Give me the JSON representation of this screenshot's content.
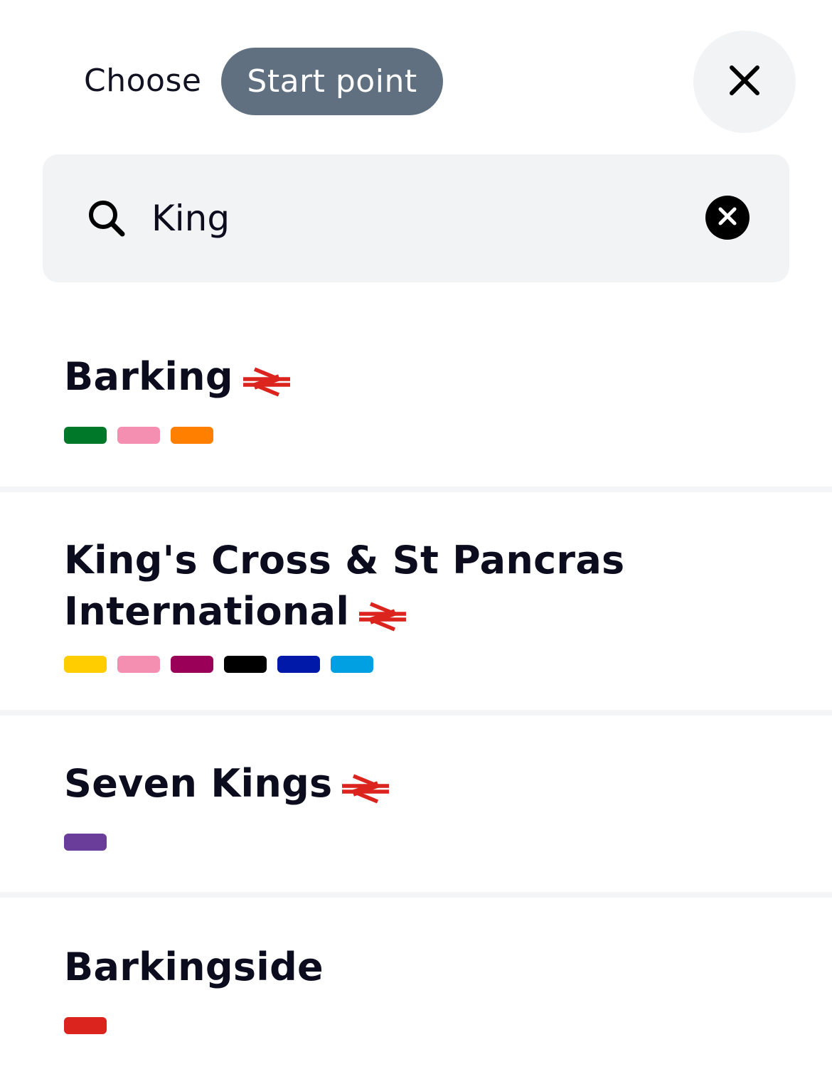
{
  "header": {
    "choose_label": "Choose",
    "mode_pill": "Start point",
    "close_icon": "close-icon"
  },
  "search": {
    "value": "King",
    "search_icon": "search-icon",
    "clear_icon": "clear-circle-icon"
  },
  "results": [
    {
      "name": "Barking",
      "national_rail": true,
      "lines": [
        "#00782a",
        "#f48fb1",
        "#ff7f00"
      ]
    },
    {
      "name": "King's Cross & St Pancras International",
      "national_rail": true,
      "lines": [
        "#ffcd00",
        "#f48fb1",
        "#9b0058",
        "#000000",
        "#0019a8",
        "#00a0e2"
      ]
    },
    {
      "name": "Seven Kings",
      "national_rail": true,
      "lines": [
        "#6a3d9a"
      ]
    },
    {
      "name": "Barkingside",
      "national_rail": false,
      "lines": [
        "#dc241f"
      ]
    }
  ],
  "colors": {
    "pill_bg": "#617080",
    "panel_bg": "#f2f3f5",
    "rail_red": "#dc241f",
    "text": "#0b0c1e"
  }
}
